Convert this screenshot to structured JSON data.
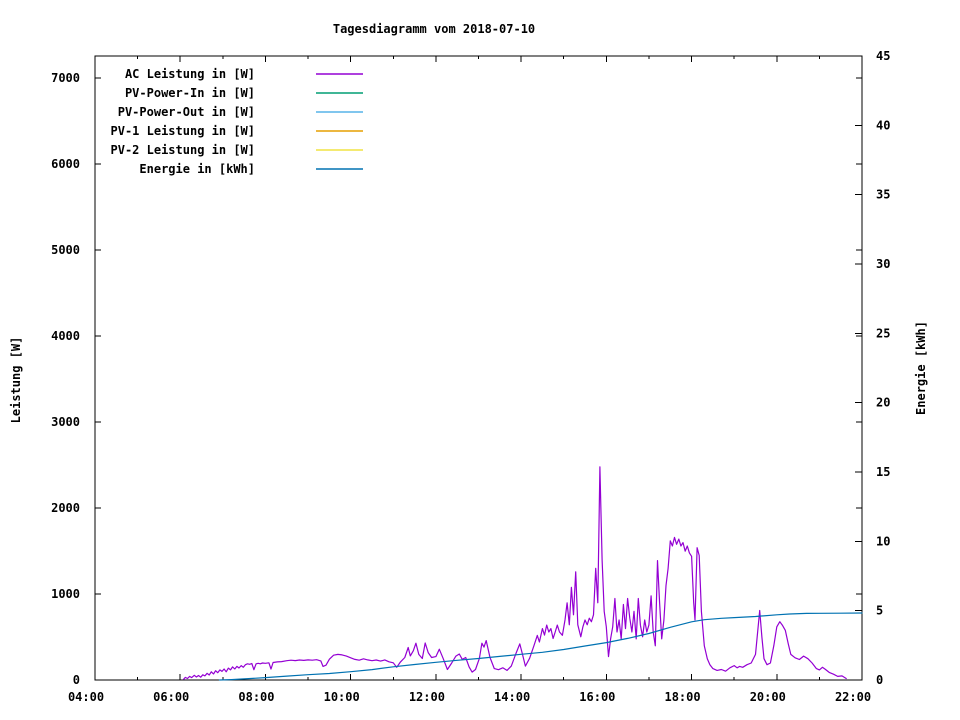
{
  "chart_data": {
    "type": "line",
    "title": "Tagesdiagramm vom 2018-07-10",
    "ylabel_left": "Leistung [W]",
    "ylabel_right": "Energie [kWh]",
    "xlim": [
      4,
      22
    ],
    "ylim_left": [
      0,
      7255
    ],
    "ylim_right": [
      0,
      45
    ],
    "grid": false,
    "legend_position": "top-left-inside",
    "x_major_ticks": [
      4,
      6,
      8,
      10,
      12,
      14,
      16,
      18,
      20,
      22
    ],
    "x_major_labels": [
      "04:00",
      "06:00",
      "08:00",
      "10:00",
      "12:00",
      "14:00",
      "16:00",
      "18:00",
      "20:00",
      "22:00"
    ],
    "x_minor_ticks": [
      5,
      7,
      9,
      11,
      13,
      15,
      17,
      19,
      21
    ],
    "y_left_ticks": [
      0,
      1000,
      2000,
      3000,
      4000,
      5000,
      6000,
      7000
    ],
    "y_left_labels": [
      "0",
      "1000",
      "2000",
      "3000",
      "4000",
      "5000",
      "6000",
      "7000"
    ],
    "y_right_ticks": [
      0,
      5,
      10,
      15,
      20,
      25,
      30,
      35,
      40,
      45
    ],
    "y_right_labels": [
      "0",
      "5",
      "10",
      "15",
      "20",
      "25",
      "30",
      "35",
      "40",
      "45"
    ],
    "colors": {
      "ac": "#9400d3",
      "pv_power_in": "#009e73",
      "pv_power_out": "#56b4e9",
      "pv1": "#e69f00",
      "pv2": "#f0e442",
      "energie": "#0072b2",
      "axis": "#000000",
      "background": "#ffffff"
    },
    "legend": [
      {
        "id": "ac",
        "label": "AC Leistung in [W]",
        "color": "#9400d3"
      },
      {
        "id": "pv-power-in",
        "label": "PV-Power-In in [W]",
        "color": "#009e73"
      },
      {
        "id": "pv-power-out",
        "label": "PV-Power-Out in [W]",
        "color": "#56b4e9"
      },
      {
        "id": "pv1",
        "label": "PV-1 Leistung in [W]",
        "color": "#e69f00"
      },
      {
        "id": "pv2",
        "label": "PV-2 Leistung in [W]",
        "color": "#f0e442"
      },
      {
        "id": "energie",
        "label": "Energie in [kWh]",
        "color": "#0072b2"
      }
    ],
    "series": [
      {
        "id": "ac-leistung",
        "name": "AC Leistung in [W]",
        "color": "#9400d3",
        "axis": "left",
        "points": [
          [
            6.08,
            8
          ],
          [
            6.12,
            30
          ],
          [
            6.17,
            18
          ],
          [
            6.22,
            42
          ],
          [
            6.27,
            28
          ],
          [
            6.33,
            55
          ],
          [
            6.38,
            35
          ],
          [
            6.43,
            52
          ],
          [
            6.48,
            32
          ],
          [
            6.53,
            60
          ],
          [
            6.58,
            48
          ],
          [
            6.63,
            78
          ],
          [
            6.68,
            58
          ],
          [
            6.73,
            95
          ],
          [
            6.78,
            70
          ],
          [
            6.83,
            108
          ],
          [
            6.88,
            85
          ],
          [
            6.93,
            118
          ],
          [
            6.98,
            100
          ],
          [
            7.03,
            128
          ],
          [
            7.08,
            95
          ],
          [
            7.13,
            138
          ],
          [
            7.18,
            118
          ],
          [
            7.23,
            152
          ],
          [
            7.28,
            128
          ],
          [
            7.33,
            158
          ],
          [
            7.38,
            140
          ],
          [
            7.43,
            168
          ],
          [
            7.48,
            148
          ],
          [
            7.53,
            178
          ],
          [
            7.58,
            188
          ],
          [
            7.63,
            182
          ],
          [
            7.68,
            192
          ],
          [
            7.73,
            120
          ],
          [
            7.78,
            188
          ],
          [
            7.83,
            194
          ],
          [
            7.88,
            188
          ],
          [
            7.93,
            198
          ],
          [
            8.0,
            194
          ],
          [
            8.08,
            200
          ],
          [
            8.13,
            128
          ],
          [
            8.18,
            204
          ],
          [
            8.28,
            210
          ],
          [
            8.38,
            214
          ],
          [
            8.5,
            224
          ],
          [
            8.6,
            230
          ],
          [
            8.7,
            226
          ],
          [
            8.8,
            232
          ],
          [
            8.9,
            228
          ],
          [
            9.0,
            234
          ],
          [
            9.1,
            230
          ],
          [
            9.2,
            236
          ],
          [
            9.3,
            222
          ],
          [
            9.35,
            158
          ],
          [
            9.42,
            172
          ],
          [
            9.5,
            242
          ],
          [
            9.6,
            288
          ],
          [
            9.7,
            298
          ],
          [
            9.8,
            292
          ],
          [
            9.9,
            278
          ],
          [
            10.0,
            258
          ],
          [
            10.1,
            240
          ],
          [
            10.2,
            230
          ],
          [
            10.3,
            246
          ],
          [
            10.4,
            234
          ],
          [
            10.5,
            224
          ],
          [
            10.6,
            232
          ],
          [
            10.7,
            220
          ],
          [
            10.8,
            234
          ],
          [
            10.9,
            212
          ],
          [
            11.0,
            200
          ],
          [
            11.08,
            148
          ],
          [
            11.17,
            210
          ],
          [
            11.27,
            262
          ],
          [
            11.35,
            378
          ],
          [
            11.4,
            280
          ],
          [
            11.47,
            340
          ],
          [
            11.53,
            428
          ],
          [
            11.6,
            298
          ],
          [
            11.68,
            250
          ],
          [
            11.75,
            430
          ],
          [
            11.82,
            318
          ],
          [
            11.9,
            262
          ],
          [
            12.0,
            272
          ],
          [
            12.08,
            358
          ],
          [
            12.17,
            252
          ],
          [
            12.27,
            122
          ],
          [
            12.37,
            198
          ],
          [
            12.47,
            278
          ],
          [
            12.55,
            302
          ],
          [
            12.62,
            240
          ],
          [
            12.7,
            262
          ],
          [
            12.78,
            152
          ],
          [
            12.85,
            92
          ],
          [
            12.93,
            122
          ],
          [
            13.02,
            252
          ],
          [
            13.08,
            428
          ],
          [
            13.13,
            382
          ],
          [
            13.18,
            458
          ],
          [
            13.27,
            262
          ],
          [
            13.37,
            132
          ],
          [
            13.47,
            120
          ],
          [
            13.57,
            142
          ],
          [
            13.67,
            112
          ],
          [
            13.77,
            162
          ],
          [
            13.87,
            298
          ],
          [
            13.97,
            420
          ],
          [
            14.03,
            302
          ],
          [
            14.1,
            162
          ],
          [
            14.2,
            252
          ],
          [
            14.3,
            398
          ],
          [
            14.38,
            518
          ],
          [
            14.43,
            442
          ],
          [
            14.5,
            598
          ],
          [
            14.55,
            522
          ],
          [
            14.6,
            638
          ],
          [
            14.65,
            558
          ],
          [
            14.7,
            598
          ],
          [
            14.75,
            482
          ],
          [
            14.8,
            558
          ],
          [
            14.85,
            638
          ],
          [
            14.9,
            558
          ],
          [
            14.97,
            520
          ],
          [
            15.03,
            698
          ],
          [
            15.08,
            898
          ],
          [
            15.13,
            642
          ],
          [
            15.18,
            1078
          ],
          [
            15.23,
            758
          ],
          [
            15.28,
            1258
          ],
          [
            15.33,
            642
          ],
          [
            15.4,
            502
          ],
          [
            15.45,
            618
          ],
          [
            15.5,
            698
          ],
          [
            15.55,
            642
          ],
          [
            15.6,
            718
          ],
          [
            15.65,
            678
          ],
          [
            15.7,
            758
          ],
          [
            15.75,
            1298
          ],
          [
            15.8,
            898
          ],
          [
            15.85,
            2478
          ],
          [
            15.9,
            1398
          ],
          [
            15.95,
            798
          ],
          [
            16.0,
            618
          ],
          [
            16.05,
            272
          ],
          [
            16.1,
            478
          ],
          [
            16.15,
            618
          ],
          [
            16.2,
            948
          ],
          [
            16.25,
            558
          ],
          [
            16.3,
            698
          ],
          [
            16.35,
            478
          ],
          [
            16.4,
            878
          ],
          [
            16.45,
            598
          ],
          [
            16.5,
            948
          ],
          [
            16.55,
            718
          ],
          [
            16.6,
            558
          ],
          [
            16.65,
            798
          ],
          [
            16.7,
            478
          ],
          [
            16.75,
            948
          ],
          [
            16.8,
            638
          ],
          [
            16.85,
            502
          ],
          [
            16.9,
            698
          ],
          [
            16.95,
            558
          ],
          [
            17.0,
            638
          ],
          [
            17.05,
            978
          ],
          [
            17.1,
            558
          ],
          [
            17.15,
            398
          ],
          [
            17.2,
            1388
          ],
          [
            17.25,
            898
          ],
          [
            17.3,
            478
          ],
          [
            17.35,
            698
          ],
          [
            17.4,
            1098
          ],
          [
            17.45,
            1298
          ],
          [
            17.5,
            1618
          ],
          [
            17.55,
            1558
          ],
          [
            17.6,
            1658
          ],
          [
            17.65,
            1578
          ],
          [
            17.7,
            1638
          ],
          [
            17.75,
            1558
          ],
          [
            17.8,
            1598
          ],
          [
            17.85,
            1498
          ],
          [
            17.9,
            1558
          ],
          [
            17.95,
            1478
          ],
          [
            18.0,
            1438
          ],
          [
            18.05,
            898
          ],
          [
            18.08,
            698
          ],
          [
            18.13,
            1538
          ],
          [
            18.18,
            1448
          ],
          [
            18.23,
            798
          ],
          [
            18.3,
            398
          ],
          [
            18.37,
            248
          ],
          [
            18.43,
            178
          ],
          [
            18.5,
            132
          ],
          [
            18.6,
            112
          ],
          [
            18.7,
            122
          ],
          [
            18.8,
            102
          ],
          [
            18.9,
            142
          ],
          [
            19.0,
            168
          ],
          [
            19.07,
            142
          ],
          [
            19.13,
            158
          ],
          [
            19.2,
            148
          ],
          [
            19.3,
            178
          ],
          [
            19.4,
            198
          ],
          [
            19.5,
            298
          ],
          [
            19.6,
            808
          ],
          [
            19.65,
            498
          ],
          [
            19.7,
            248
          ],
          [
            19.77,
            178
          ],
          [
            19.85,
            198
          ],
          [
            19.93,
            398
          ],
          [
            20.0,
            618
          ],
          [
            20.07,
            678
          ],
          [
            20.13,
            638
          ],
          [
            20.2,
            578
          ],
          [
            20.27,
            418
          ],
          [
            20.33,
            298
          ],
          [
            20.43,
            258
          ],
          [
            20.53,
            238
          ],
          [
            20.63,
            278
          ],
          [
            20.73,
            248
          ],
          [
            20.83,
            198
          ],
          [
            20.93,
            132
          ],
          [
            21.0,
            118
          ],
          [
            21.07,
            148
          ],
          [
            21.13,
            128
          ],
          [
            21.23,
            88
          ],
          [
            21.33,
            68
          ],
          [
            21.43,
            42
          ],
          [
            21.53,
            48
          ],
          [
            21.63,
            18
          ]
        ]
      },
      {
        "id": "energie",
        "name": "Energie in [kWh]",
        "color": "#0072b2",
        "axis": "right",
        "points": [
          [
            6.92,
            0
          ],
          [
            7.2,
            0.03
          ],
          [
            7.5,
            0.08
          ],
          [
            8.0,
            0.17
          ],
          [
            8.5,
            0.28
          ],
          [
            9.0,
            0.38
          ],
          [
            9.5,
            0.47
          ],
          [
            10.0,
            0.6
          ],
          [
            10.5,
            0.75
          ],
          [
            11.0,
            0.95
          ],
          [
            11.5,
            1.12
          ],
          [
            12.0,
            1.28
          ],
          [
            12.5,
            1.42
          ],
          [
            13.0,
            1.55
          ],
          [
            13.5,
            1.7
          ],
          [
            14.0,
            1.85
          ],
          [
            14.5,
            2.0
          ],
          [
            15.0,
            2.2
          ],
          [
            15.5,
            2.45
          ],
          [
            16.0,
            2.7
          ],
          [
            16.5,
            3.0
          ],
          [
            17.0,
            3.35
          ],
          [
            17.5,
            3.8
          ],
          [
            18.0,
            4.2
          ],
          [
            18.3,
            4.35
          ],
          [
            18.7,
            4.45
          ],
          [
            19.0,
            4.5
          ],
          [
            19.5,
            4.58
          ],
          [
            20.0,
            4.7
          ],
          [
            20.3,
            4.76
          ],
          [
            20.7,
            4.8
          ],
          [
            21.0,
            4.81
          ],
          [
            21.5,
            4.82
          ],
          [
            22.0,
            4.83
          ]
        ]
      }
    ]
  }
}
